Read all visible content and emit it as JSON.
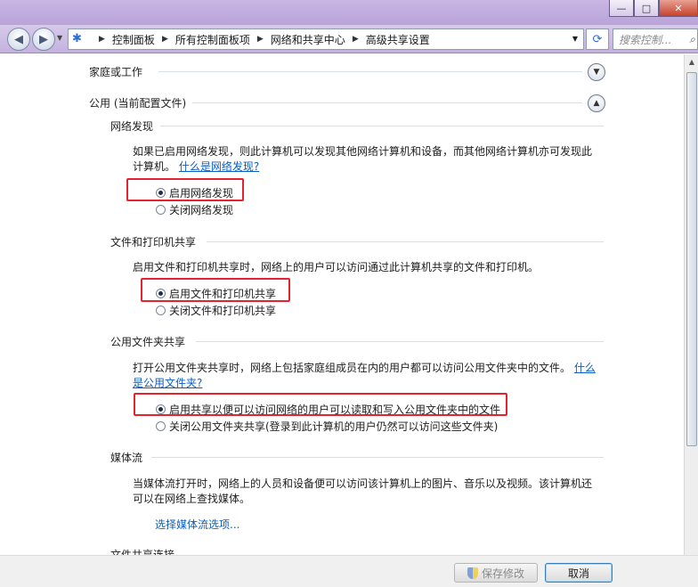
{
  "window": {
    "controls": {
      "minimize": "—",
      "maximize": "□",
      "close": "✕"
    }
  },
  "navbar": {
    "breadcrumbs": [
      "控制面板",
      "所有控制面板项",
      "网络和共享中心",
      "高级共享设置"
    ],
    "search_placeholder": "搜索控制..."
  },
  "profiles": {
    "home": {
      "label": "家庭或工作"
    },
    "public": {
      "label": "公用 (当前配置文件)"
    }
  },
  "sections": {
    "discovery": {
      "title": "网络发现",
      "desc": "如果已启用网络发现，则此计算机可以发现其他网络计算机和设备，而其他网络计算机亦可发现此计算机。",
      "link": "什么是网络发现?",
      "options": [
        "启用网络发现",
        "关闭网络发现"
      ],
      "selected": 0
    },
    "file_print": {
      "title": "文件和打印机共享",
      "desc": "启用文件和打印机共享时，网络上的用户可以访问通过此计算机共享的文件和打印机。",
      "options": [
        "启用文件和打印机共享",
        "关闭文件和打印机共享"
      ],
      "selected": 0
    },
    "public_folder": {
      "title": "公用文件夹共享",
      "desc": "打开公用文件夹共享时，网络上包括家庭组成员在内的用户都可以访问公用文件夹中的文件。",
      "link": "什么是公用文件夹?",
      "options": [
        "启用共享以便可以访问网络的用户可以读取和写入公用文件夹中的文件",
        "关闭公用文件夹共享(登录到此计算机的用户仍然可以访问这些文件夹)"
      ],
      "selected": 0
    },
    "media": {
      "title": "媒体流",
      "desc": "当媒体流打开时，网络上的人员和设备便可以访问该计算机上的图片、音乐以及视频。该计算机还可以在网络上查找媒体。",
      "link": "选择媒体流选项...",
      "next_title": "文件共享连接"
    }
  },
  "footer": {
    "save_label": "保存修改",
    "cancel_label": "取消"
  },
  "colors": {
    "highlight": "#e4232e",
    "link": "#0a5fc4"
  }
}
